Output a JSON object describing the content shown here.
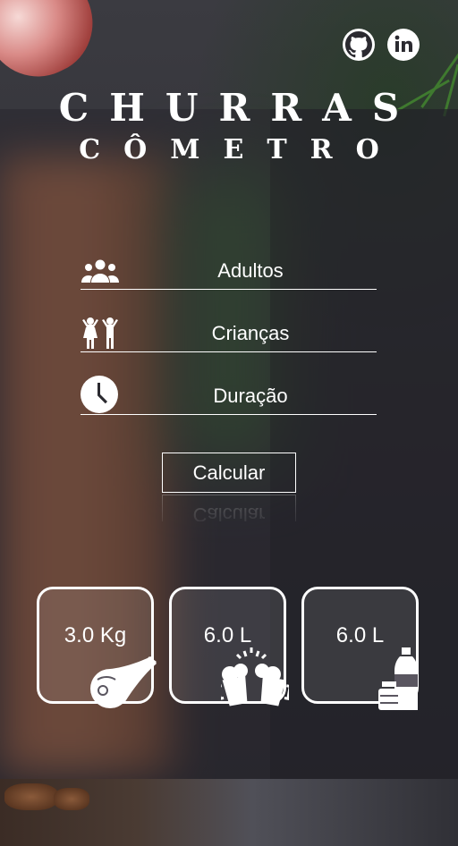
{
  "header": {
    "title": "CHURRAS",
    "subtitle": "CÔMETRO",
    "social_icons": [
      "github-icon",
      "linkedin-icon"
    ]
  },
  "form": {
    "adults_placeholder": "Adultos",
    "children_placeholder": "Crianças",
    "duration_placeholder": "Duração",
    "adults_value": "",
    "children_value": "",
    "duration_value": "",
    "icons": [
      "people-group-icon",
      "children-icon",
      "clock-icon"
    ]
  },
  "actions": {
    "calculate_label": "Calcular"
  },
  "results": [
    {
      "value": "3.0 Kg",
      "icon": "ham-leg-icon"
    },
    {
      "value": "6.0 L",
      "icon": "beer-mugs-icon"
    },
    {
      "value": "6.0 L",
      "icon": "bottles-icon"
    }
  ],
  "colors": {
    "text": "#ffffff",
    "overlay": "#28262d"
  }
}
